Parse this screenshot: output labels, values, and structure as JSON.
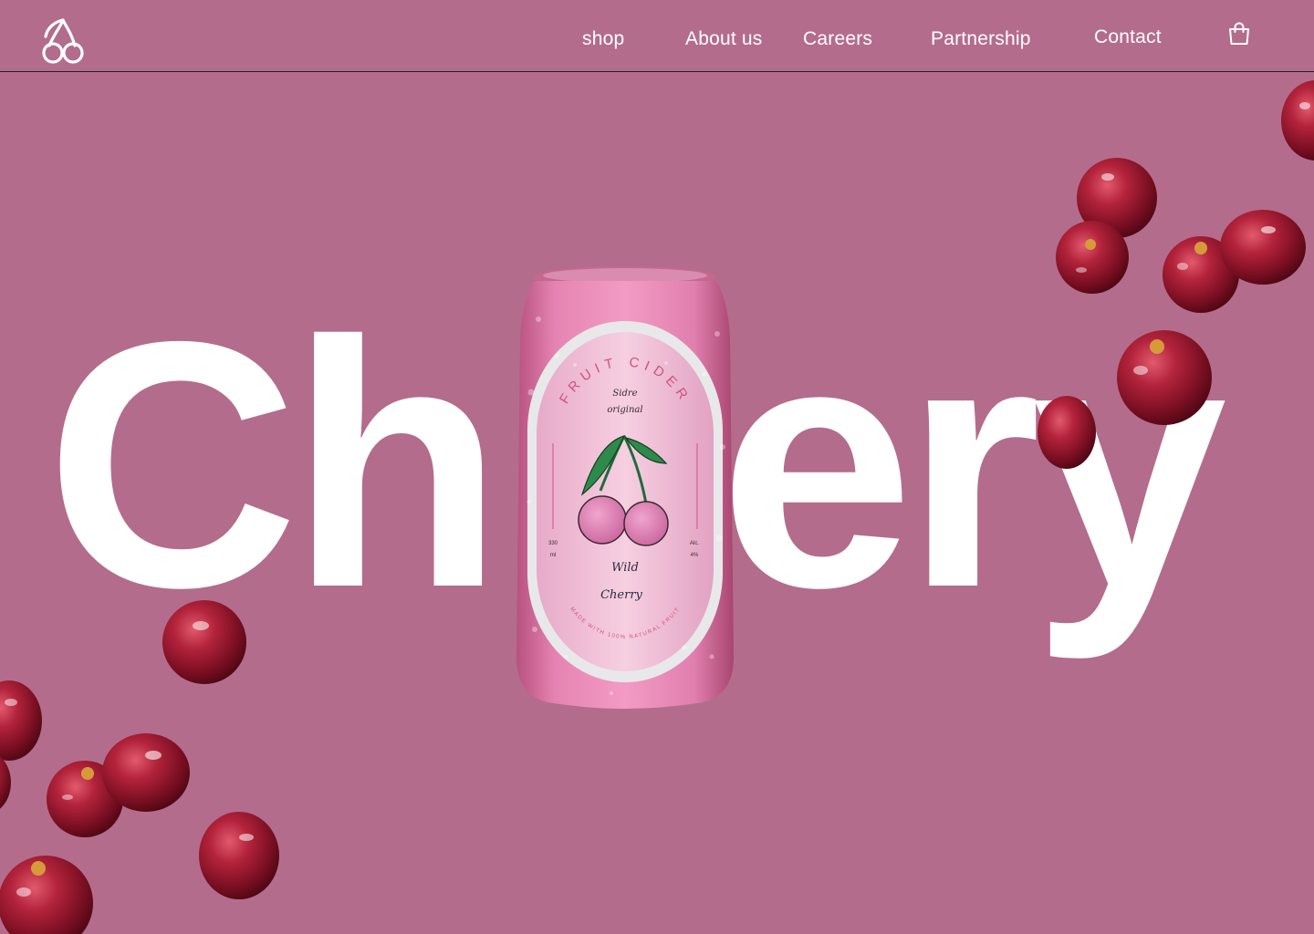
{
  "brand": {
    "logo_icon": "cherry-logo-icon"
  },
  "nav": {
    "items": [
      {
        "label": "shop"
      },
      {
        "label": "About us"
      },
      {
        "label": "Careers"
      },
      {
        "label": "Partnership"
      },
      {
        "label": "Contact"
      }
    ],
    "cart_icon": "shopping-bag-icon"
  },
  "hero": {
    "title_left": "Ch",
    "title_right": "ery",
    "background_color": "#b46c8c",
    "text_color": "#ffffff"
  },
  "can": {
    "arc_text": "FRUIT CIDER",
    "subtitle_line1": "Sidre",
    "subtitle_line2": "original",
    "volume_value": "330",
    "volume_unit": "ml",
    "alc_label": "Alc.",
    "alc_value": "4%",
    "name_line1": "Wild",
    "name_line2": "Cherry",
    "bottom_arc_text": "MADE WITH 100% NATURAL FRUIT",
    "can_color": "#e07fae",
    "label_color": "#f0bfd6"
  }
}
